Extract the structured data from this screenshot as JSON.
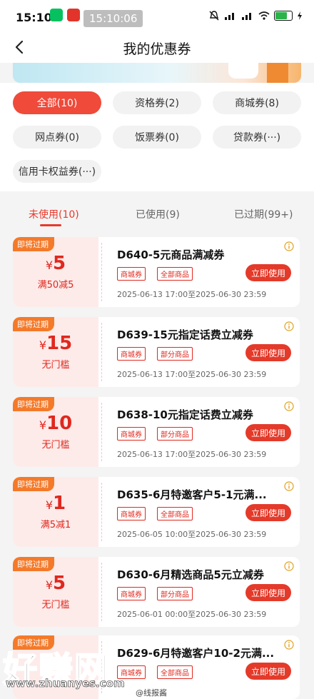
{
  "status_bar": {
    "time": "15:10",
    "overlay_time": "15:10:06",
    "battery": "89"
  },
  "nav": {
    "title": "我的优惠券"
  },
  "filters": [
    {
      "label": "全部(10)",
      "active": true
    },
    {
      "label": "资格券(2)"
    },
    {
      "label": "商城券(8)"
    },
    {
      "label": "网点券(0)"
    },
    {
      "label": "饭票券(0)"
    },
    {
      "label": "贷款券(···)"
    },
    {
      "label": "信用卡权益券(···)"
    }
  ],
  "tabs": [
    {
      "label": "未使用(10)",
      "active": true
    },
    {
      "label": "已使用(9)"
    },
    {
      "label": "已过期(99+)"
    }
  ],
  "coupons": [
    {
      "expire_badge": "即将过期",
      "currency": "¥",
      "amount": "5",
      "condition": "满50减5",
      "title": "D640-5元商品满减券",
      "tags": [
        "商城券",
        "全部商品"
      ],
      "button": "立即使用",
      "date": "2025-06-13 17:00至2025-06-30 23:59"
    },
    {
      "expire_badge": "即将过期",
      "currency": "¥",
      "amount": "15",
      "condition": "无门槛",
      "title": "D639-15元指定话费立减券",
      "tags": [
        "商城券",
        "部分商品"
      ],
      "button": "立即使用",
      "date": "2025-06-13 17:00至2025-06-30 23:59"
    },
    {
      "expire_badge": "即将过期",
      "currency": "¥",
      "amount": "10",
      "condition": "无门槛",
      "title": "D638-10元指定话费立减券",
      "tags": [
        "商城券",
        "部分商品"
      ],
      "button": "立即使用",
      "date": "2025-06-13 17:00至2025-06-30 23:59"
    },
    {
      "expire_badge": "即将过期",
      "currency": "¥",
      "amount": "1",
      "condition": "满5减1",
      "title": "D635-6月特邀客户5-1元满...",
      "tags": [
        "商城券",
        "全部商品"
      ],
      "button": "立即使用",
      "date": "2025-06-05 10:00至2025-06-30 23:59"
    },
    {
      "expire_badge": "即将过期",
      "currency": "¥",
      "amount": "5",
      "condition": "无门槛",
      "title": "D630-6月精选商品5元立减券",
      "tags": [
        "商城券",
        "部分商品"
      ],
      "button": "立即使用",
      "date": "2025-06-01 00:00至2025-06-30 23:59"
    },
    {
      "expire_badge": "即将过期",
      "currency": "¥",
      "amount": "",
      "condition": "",
      "title": "D629-6月特邀客户10-2元满...",
      "tags": [
        "商城券",
        "全部商品"
      ],
      "button": "立即使用",
      "date": ""
    }
  ],
  "watermark": {
    "brand": "好赚网",
    "url": "www.zhuanyes.com",
    "weibo": "@线报酱"
  },
  "colors": {
    "accent": "#e43a2a",
    "badge": "#f47a2a",
    "coupon_left_bg": "#fdebea"
  }
}
